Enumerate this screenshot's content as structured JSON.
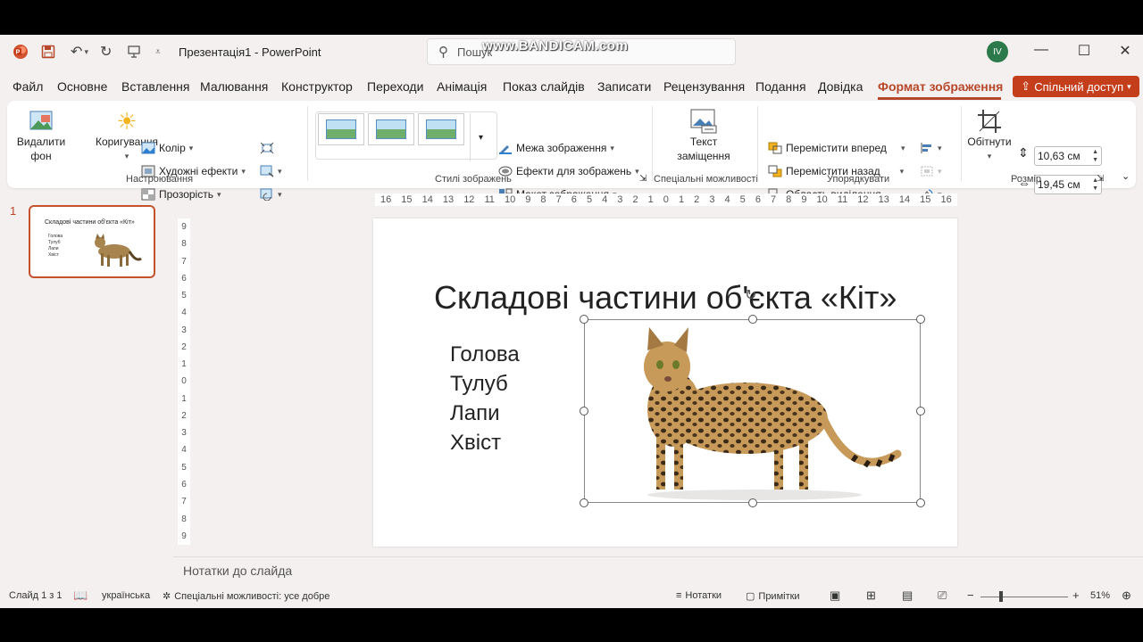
{
  "window": {
    "doc_title": "Презентація1",
    "app_separator": "-",
    "app_name": "PowerPoint",
    "avatar": "IV",
    "watermark": "www.BANDICAM.com"
  },
  "search": {
    "placeholder": "Пошук"
  },
  "menu": {
    "items": [
      "Файл",
      "Основне",
      "Вставлення",
      "Малювання",
      "Конструктор",
      "Переходи",
      "Анімація",
      "Показ слайдів",
      "Записати",
      "Рецензування",
      "Подання",
      "Довідка",
      "Формат зображення"
    ],
    "active": "Формат зображення",
    "share": "Спільний доступ"
  },
  "ribbon": {
    "remove_bg": [
      "Видалити",
      "фон"
    ],
    "corrections": "Коригування",
    "color": "Колір",
    "artistic": "Художні ефекти",
    "transparency": "Прозорість",
    "group_adjust": "Настроювання",
    "border": "Межа зображення",
    "effects": "Ефекти для зображень",
    "layout": "Макет зображення",
    "group_styles": "Стилі зображень",
    "alt_text": [
      "Текст",
      "заміщення"
    ],
    "group_access": "Спеціальні можливості",
    "forward": "Перемістити вперед",
    "backward": "Перемістити назад",
    "selection_pane": "Область виділення",
    "group_arrange": "Упорядкувати",
    "crop": "Обітнути",
    "height": "10,63 см",
    "width": "19,45 см",
    "group_size": "Розмір"
  },
  "thumbnail": {
    "number": "1",
    "title": "Складові частини об'єкта «Кіт»",
    "items": [
      "Голова",
      "Тулуб",
      "Лапи",
      "Хвіст"
    ]
  },
  "ruler": {
    "h": [
      "16",
      "15",
      "14",
      "13",
      "12",
      "11",
      "10",
      "9",
      "8",
      "7",
      "6",
      "5",
      "4",
      "3",
      "2",
      "1",
      "0",
      "1",
      "2",
      "3",
      "4",
      "5",
      "6",
      "7",
      "8",
      "9",
      "10",
      "11",
      "12",
      "13",
      "14",
      "15",
      "16"
    ],
    "v": [
      "9",
      "8",
      "7",
      "6",
      "5",
      "4",
      "3",
      "2",
      "1",
      "0",
      "1",
      "2",
      "3",
      "4",
      "5",
      "6",
      "7",
      "8",
      "9"
    ]
  },
  "slide": {
    "title": "Складові частини об'єкта «Кіт»",
    "items": [
      "Голова",
      "Тулуб",
      "Лапи",
      "Хвіст"
    ]
  },
  "notes": {
    "placeholder": "Нотатки до слайда"
  },
  "status": {
    "slide": "Слайд 1 з 1",
    "language": "українська",
    "accessibility": "Спеціальні можливості: усе добре",
    "notes": "Нотатки",
    "comments": "Примітки",
    "zoom": "51%"
  },
  "colors": {
    "accent": "#b7472a",
    "share": "#c43e1c",
    "avatar": "#2c7a4b"
  }
}
